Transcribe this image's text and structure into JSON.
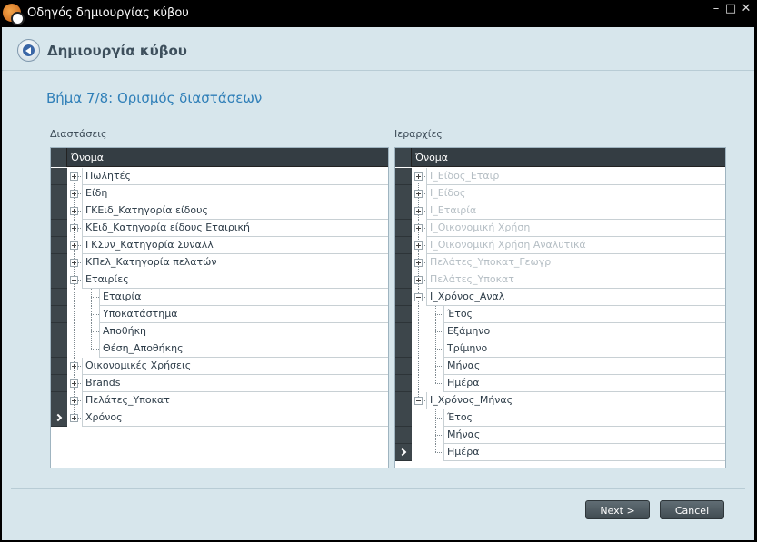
{
  "window": {
    "title": "Οδηγός δημιουργίας κύβου"
  },
  "header": {
    "title": "Δημιουργία κύβου"
  },
  "step": {
    "title": "Βήμα 7/8: Ορισμός διαστάσεων"
  },
  "left_panel": {
    "label": "Διαστάσεις",
    "column_header": "Όνομα",
    "rows": [
      {
        "label": "Πωλητές",
        "level": 0,
        "expander": "collapsed",
        "dim": false
      },
      {
        "label": "Είδη",
        "level": 0,
        "expander": "collapsed",
        "dim": false
      },
      {
        "label": "ΓΚΕιδ_Κατηγορία είδους",
        "level": 0,
        "expander": "collapsed",
        "dim": false
      },
      {
        "label": "ΚΕιδ_Κατηγορία είδους Εταιρική",
        "level": 0,
        "expander": "collapsed",
        "dim": false
      },
      {
        "label": "ΓΚΣυν_Κατηγορία Συναλλ",
        "level": 0,
        "expander": "collapsed",
        "dim": false
      },
      {
        "label": "ΚΠελ_Κατηγορία πελατών",
        "level": 0,
        "expander": "collapsed",
        "dim": false
      },
      {
        "label": "Εταιρίες",
        "level": 0,
        "expander": "expanded",
        "dim": false
      },
      {
        "label": "Εταιρία",
        "level": 1,
        "expander": "none",
        "dim": false
      },
      {
        "label": "Υποκατάστημα",
        "level": 1,
        "expander": "none",
        "dim": false
      },
      {
        "label": "Αποθήκη",
        "level": 1,
        "expander": "none",
        "dim": false
      },
      {
        "label": "Θέση_Αποθήκης",
        "level": 1,
        "expander": "none",
        "dim": false,
        "last_child": true
      },
      {
        "label": "Οικονομικές Χρήσεις",
        "level": 0,
        "expander": "collapsed",
        "dim": false
      },
      {
        "label": "Brands",
        "level": 0,
        "expander": "collapsed",
        "dim": false
      },
      {
        "label": "Πελάτες_Υποκατ",
        "level": 0,
        "expander": "collapsed",
        "dim": false
      },
      {
        "label": "Χρόνος",
        "level": 0,
        "expander": "collapsed",
        "dim": false,
        "active": true
      }
    ]
  },
  "right_panel": {
    "label": "Ιεραρχίες",
    "column_header": "Όνομα",
    "rows": [
      {
        "label": "Ι_Είδος_Εταιρ",
        "level": 0,
        "expander": "collapsed",
        "dim": true
      },
      {
        "label": "Ι_Είδος",
        "level": 0,
        "expander": "collapsed",
        "dim": true
      },
      {
        "label": "Ι_Εταιρία",
        "level": 0,
        "expander": "collapsed",
        "dim": true
      },
      {
        "label": "Ι_Οικονομική Χρήση",
        "level": 0,
        "expander": "collapsed",
        "dim": true
      },
      {
        "label": "Ι_Οικονομική Χρήση Αναλυτικά",
        "level": 0,
        "expander": "collapsed",
        "dim": true
      },
      {
        "label": "Πελάτες_Υποκατ_Γεωγρ",
        "level": 0,
        "expander": "collapsed",
        "dim": true
      },
      {
        "label": "Πελάτες_Υποκατ",
        "level": 0,
        "expander": "collapsed",
        "dim": true
      },
      {
        "label": "Ι_Χρόνος_Αναλ",
        "level": 0,
        "expander": "expanded",
        "dim": false
      },
      {
        "label": "Έτος",
        "level": 1,
        "expander": "none",
        "dim": false
      },
      {
        "label": "Εξάμηνο",
        "level": 1,
        "expander": "none",
        "dim": false
      },
      {
        "label": "Τρίμηνο",
        "level": 1,
        "expander": "none",
        "dim": false
      },
      {
        "label": "Μήνας",
        "level": 1,
        "expander": "none",
        "dim": false
      },
      {
        "label": "Ημέρα",
        "level": 1,
        "expander": "none",
        "dim": false,
        "last_child": true
      },
      {
        "label": "Ι_Χρόνος_Μήνας",
        "level": 0,
        "expander": "expanded",
        "dim": false
      },
      {
        "label": "Έτος",
        "level": 1,
        "expander": "none",
        "dim": false
      },
      {
        "label": "Μήνας",
        "level": 1,
        "expander": "none",
        "dim": false
      },
      {
        "label": "Ημέρα",
        "level": 1,
        "expander": "none",
        "dim": false,
        "active": true,
        "last_child": true
      }
    ]
  },
  "buttons": {
    "next": "Next >",
    "cancel": "Cancel"
  },
  "colors": {
    "accent": "#2f7fb8",
    "background": "#d7e6ec",
    "grid_header": "#343d43"
  }
}
